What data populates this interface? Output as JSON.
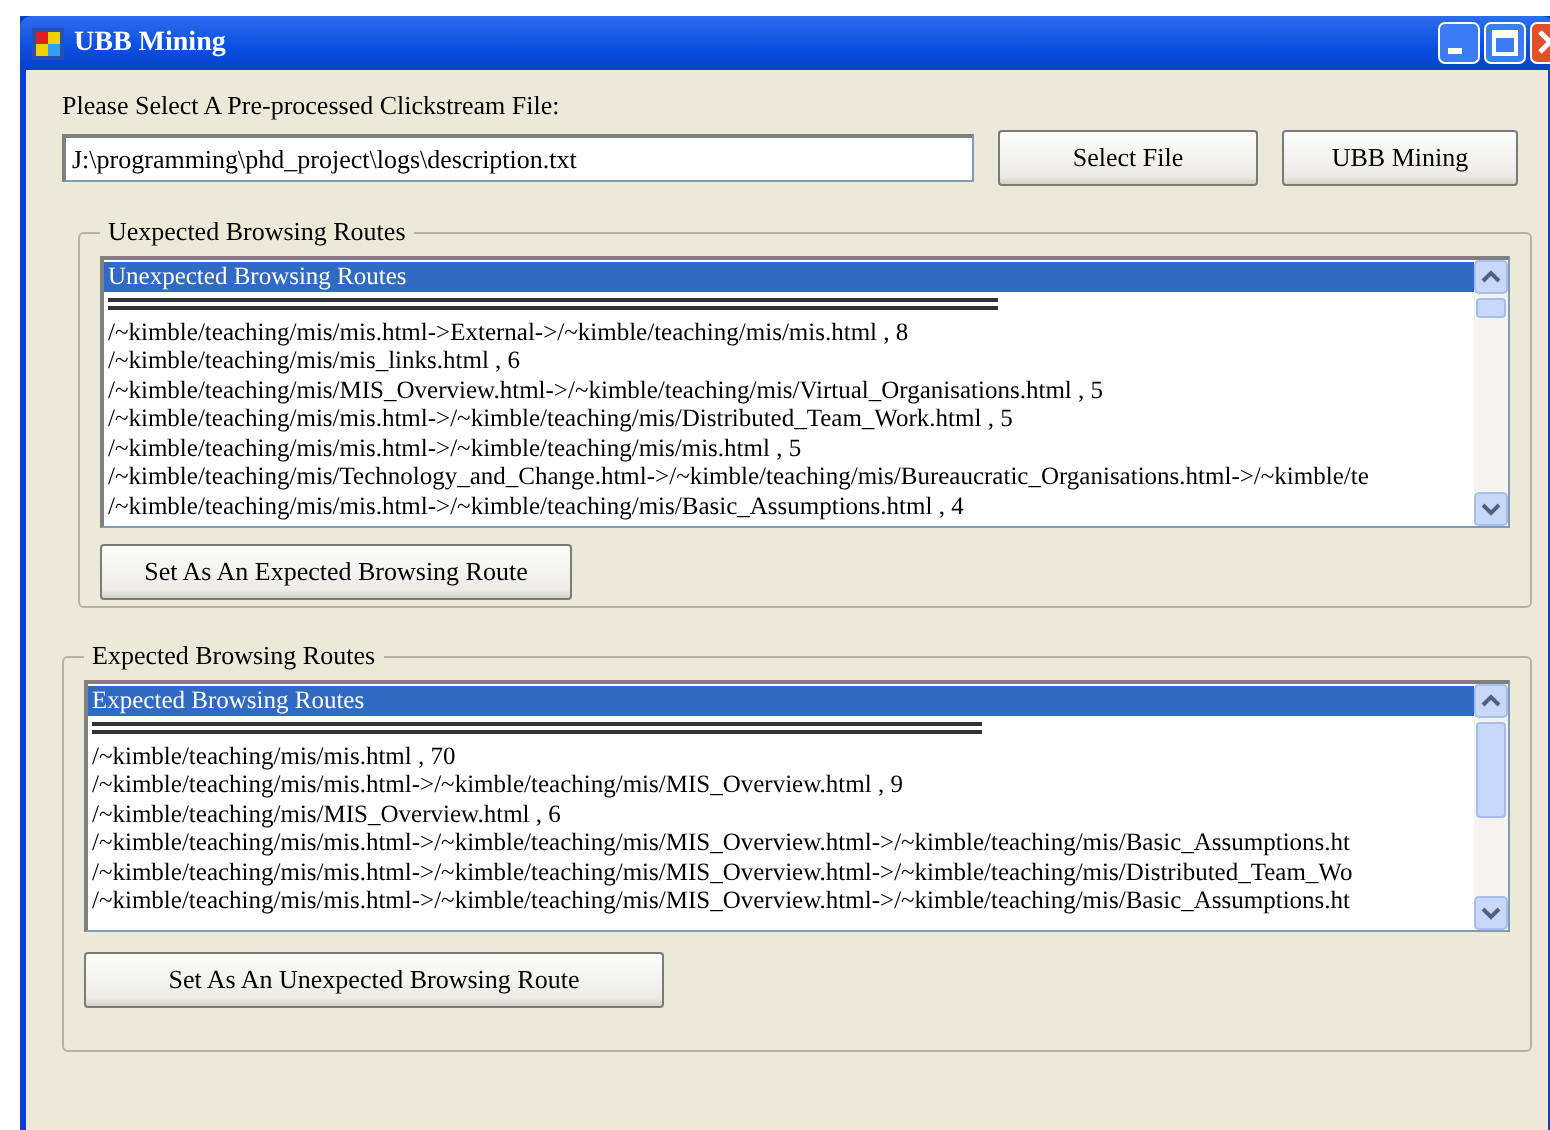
{
  "window": {
    "title": "UBB Mining"
  },
  "file_label": "Please Select A Pre-processed Clickstream File:",
  "file_field": {
    "value": "J:\\programming\\phd_project\\logs\\description.txt"
  },
  "buttons": [
    "Select File",
    "UBB Mining"
  ],
  "groups": [
    {
      "title": "Uexpected Browsing Routes",
      "list": {
        "items": [
          {
            "text": "Unexpected Browsing Routes",
            "selected": true
          },
          {
            "text": "/~kimble/teaching/mis/mis.html->External->/~kimble/teaching/mis/mis.html , 8",
            "selected": false
          },
          {
            "text": "/~kimble/teaching/mis/mis_links.html , 6",
            "selected": false
          },
          {
            "text": "/~kimble/teaching/mis/MIS_Overview.html->/~kimble/teaching/mis/Virtual_Organisations.html , 5",
            "selected": false
          },
          {
            "text": "/~kimble/teaching/mis/mis.html->/~kimble/teaching/mis/Distributed_Team_Work.html , 5",
            "selected": false
          },
          {
            "text": "/~kimble/teaching/mis/mis.html->/~kimble/teaching/mis/mis.html , 5",
            "selected": false
          },
          {
            "text": "/~kimble/teaching/mis/Technology_and_Change.html->/~kimble/teaching/mis/Bureaucratic_Organisations.html->/~kimble/te",
            "selected": false
          },
          {
            "text": "/~kimble/teaching/mis/mis.html->/~kimble/teaching/mis/Basic_Assumptions.html , 4",
            "selected": false
          }
        ]
      },
      "button": "Set As An Expected Browsing Route"
    },
    {
      "title": "Expected Browsing Routes",
      "list": {
        "items": [
          {
            "text": "Expected Browsing Routes",
            "selected": true
          },
          {
            "text": "/~kimble/teaching/mis/mis.html , 70",
            "selected": false
          },
          {
            "text": "/~kimble/teaching/mis/mis.html->/~kimble/teaching/mis/MIS_Overview.html , 9",
            "selected": false
          },
          {
            "text": "/~kimble/teaching/mis/MIS_Overview.html , 6",
            "selected": false
          },
          {
            "text": "/~kimble/teaching/mis/mis.html->/~kimble/teaching/mis/MIS_Overview.html->/~kimble/teaching/mis/Basic_Assumptions.ht",
            "selected": false
          },
          {
            "text": "/~kimble/teaching/mis/mis.html->/~kimble/teaching/mis/MIS_Overview.html->/~kimble/teaching/mis/Distributed_Team_Wo",
            "selected": false
          },
          {
            "text": "/~kimble/teaching/mis/mis.html->/~kimble/teaching/mis/MIS_Overview.html->/~kimble/teaching/mis/Basic_Assumptions.ht",
            "selected": false
          }
        ]
      },
      "button": "Set As An Unexpected Browsing Route"
    }
  ]
}
